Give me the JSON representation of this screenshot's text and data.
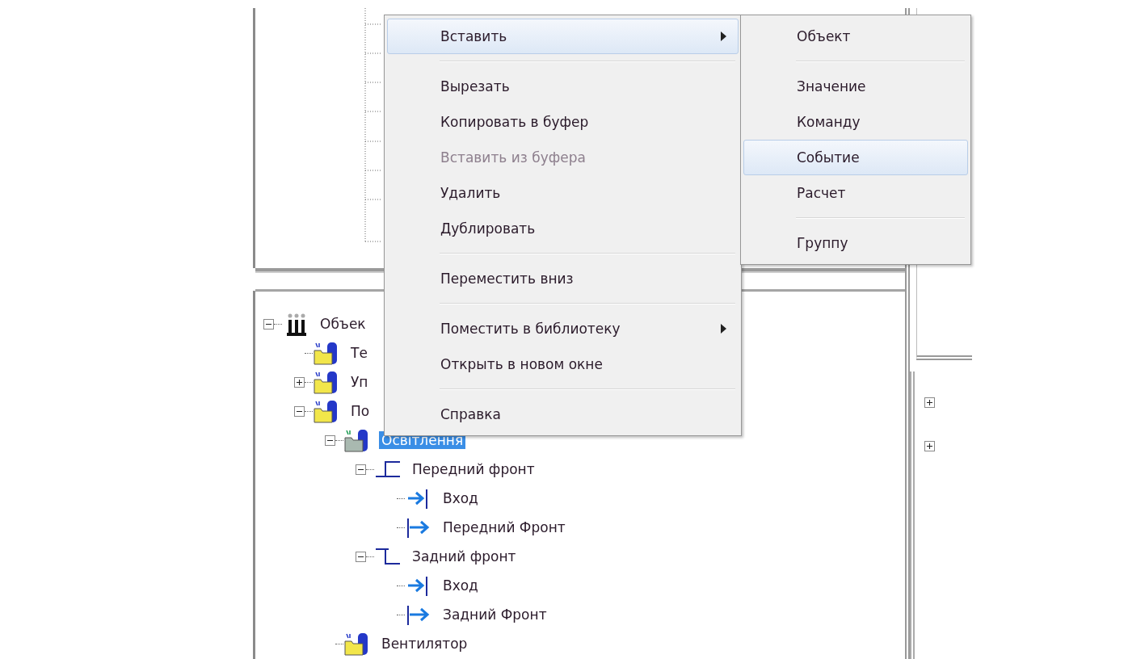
{
  "tree": [
    {
      "label": "Объек",
      "kind": "root",
      "expanded": true,
      "selected": false,
      "children": [
        {
          "label": "Те",
          "kind": "folder",
          "selected": false
        },
        {
          "label": "Уп",
          "kind": "folder",
          "expanded": false,
          "selected": false
        },
        {
          "label": "По",
          "kind": "folder",
          "expanded": true,
          "selected": false,
          "children": [
            {
              "label": "Освітлення",
              "kind": "device",
              "expanded": true,
              "selected": true,
              "children": [
                {
                  "label": "Передний фронт",
                  "kind": "edge-rise",
                  "expanded": true,
                  "selected": false,
                  "children": [
                    {
                      "label": "Вход",
                      "kind": "input",
                      "selected": false
                    },
                    {
                      "label": "Передний Фронт",
                      "kind": "output",
                      "selected": false
                    }
                  ]
                },
                {
                  "label": "Задний фронт",
                  "kind": "edge-fall",
                  "expanded": true,
                  "selected": false,
                  "children": [
                    {
                      "label": "Вход",
                      "kind": "input",
                      "selected": false
                    },
                    {
                      "label": "Задний Фронт",
                      "kind": "output",
                      "selected": false
                    }
                  ]
                }
              ]
            },
            {
              "label": "Вентилятор",
              "kind": "folder",
              "selected": false
            }
          ]
        }
      ]
    }
  ],
  "context_menu": [
    {
      "kind": "item",
      "label": "Вставить",
      "submenu": true,
      "disabled": false,
      "selected": true
    },
    {
      "kind": "separator"
    },
    {
      "kind": "item",
      "label": "Вырезать",
      "submenu": false,
      "disabled": false,
      "selected": false
    },
    {
      "kind": "item",
      "label": "Копировать в буфер",
      "submenu": false,
      "disabled": false,
      "selected": false
    },
    {
      "kind": "item",
      "label": "Вставить из буфера",
      "submenu": false,
      "disabled": true,
      "selected": false
    },
    {
      "kind": "item",
      "label": "Удалить",
      "submenu": false,
      "disabled": false,
      "selected": false
    },
    {
      "kind": "item",
      "label": "Дублировать",
      "submenu": false,
      "disabled": false,
      "selected": false
    },
    {
      "kind": "separator"
    },
    {
      "kind": "item",
      "label": "Переместить вниз",
      "submenu": false,
      "disabled": false,
      "selected": false
    },
    {
      "kind": "separator"
    },
    {
      "kind": "item",
      "label": "Поместить в библиотеку",
      "submenu": true,
      "disabled": false,
      "selected": false
    },
    {
      "kind": "item",
      "label": "Открыть в новом окне",
      "submenu": false,
      "disabled": false,
      "selected": false
    },
    {
      "kind": "separator"
    },
    {
      "kind": "item",
      "label": "Справка",
      "submenu": false,
      "disabled": false,
      "selected": false
    }
  ],
  "submenu": [
    {
      "kind": "item",
      "label": "Объект",
      "submenu": false,
      "disabled": false,
      "selected": false
    },
    {
      "kind": "separator"
    },
    {
      "kind": "item",
      "label": "Значение",
      "submenu": false,
      "disabled": false,
      "selected": false
    },
    {
      "kind": "item",
      "label": "Команду",
      "submenu": false,
      "disabled": false,
      "selected": false
    },
    {
      "kind": "item",
      "label": "Событие",
      "submenu": false,
      "disabled": false,
      "selected": true
    },
    {
      "kind": "item",
      "label": "Расчет",
      "submenu": false,
      "disabled": false,
      "selected": false
    },
    {
      "kind": "separator"
    },
    {
      "kind": "item",
      "label": "Группу",
      "submenu": false,
      "disabled": false,
      "selected": false
    }
  ]
}
